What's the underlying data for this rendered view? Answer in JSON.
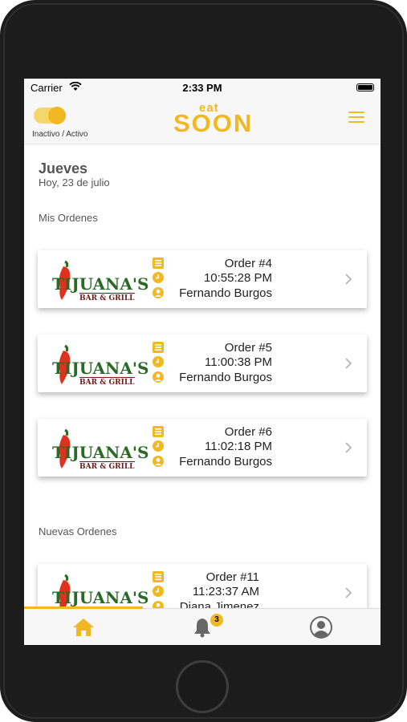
{
  "status_bar": {
    "carrier": "Carrier",
    "time": "2:33 PM"
  },
  "nav": {
    "toggle_label": "Inactivo / Activo",
    "logo_top": "eat",
    "logo_main": "SOON"
  },
  "header": {
    "day": "Jueves",
    "date": "Hoy, 23 de julio"
  },
  "sections": {
    "mis_ordenes": "Mis Ordenes",
    "nuevas_ordenes": "Nuevas Ordenes"
  },
  "restaurant": {
    "name": "TIJUANA'S",
    "sub": "BAR & GRILL"
  },
  "orders": [
    {
      "order": "Order #4",
      "time": "10:55:28 PM",
      "customer": "Fernando Burgos"
    },
    {
      "order": "Order #5",
      "time": "11:00:38 PM",
      "customer": "Fernando Burgos"
    },
    {
      "order": "Order #6",
      "time": "11:02:18 PM",
      "customer": "Fernando Burgos"
    },
    {
      "order": "Order #11",
      "time": "11:23:37 AM",
      "customer": "Diana Jimenez"
    }
  ],
  "tabs": {
    "home_icon": "house-icon",
    "notifications_icon": "bell-icon",
    "notifications_badge": "3",
    "profile_icon": "user-icon"
  },
  "colors": {
    "accent": "#f0b823",
    "logo_green": "#2b6a26",
    "chili_red": "#e0301e"
  }
}
